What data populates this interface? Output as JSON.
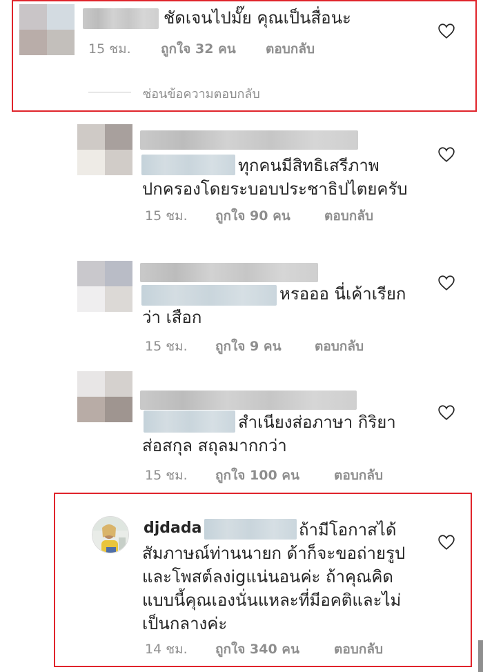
{
  "comments": [
    {
      "text_lines": [
        "ชัดเจนไปมั๊ย คุณเป็นสื่อนะ"
      ],
      "time": "15 ชม.",
      "likes": "ถูกใจ 32 คน",
      "reply": "ตอบกลับ",
      "hide_replies": "ซ่อนข้อความตอบกลับ"
    },
    {
      "text_lines": [
        "ทุกคนมีสิทธิเสรีภาพ",
        "ปกครองโดยระบอบประชาธิปไตยครับ"
      ],
      "time": "15 ชม.",
      "likes": "ถูกใจ 90 คน",
      "reply": "ตอบกลับ"
    },
    {
      "text_lines": [
        "หรอออ  นี่เค้าเรียก",
        "ว่า เสือก"
      ],
      "time": "15 ชม.",
      "likes": "ถูกใจ 9 คน",
      "reply": "ตอบกลับ"
    },
    {
      "text_lines": [
        "สำเนียงส่อภาษา กิริยา",
        "ส่อสกุล สถุลมากกว่า"
      ],
      "time": "15 ชม.",
      "likes": "ถูกใจ 100 คน",
      "reply": "ตอบกลับ"
    },
    {
      "username": "djdada",
      "text_lines": [
        "ถ้ามีโอกาสได้",
        "สัมภาษณ์ท่านนายก ด้าก็จะขอถ่ายรูป",
        "และโพสต์ลงigแน่นอนค่ะ ถ้าคุณคิด",
        "แบบนี้คุณเองนั่นแหละที่มีอคติและไม่",
        "เป็นกลางค่ะ"
      ],
      "time": "14 ชม.",
      "likes": "ถูกใจ 340 คน",
      "reply": "ตอบกลับ"
    }
  ],
  "icons": {
    "like": "heart-outline-icon"
  },
  "colors": {
    "highlight_border": "#e0242b",
    "meta_text": "#8e8e8e"
  }
}
